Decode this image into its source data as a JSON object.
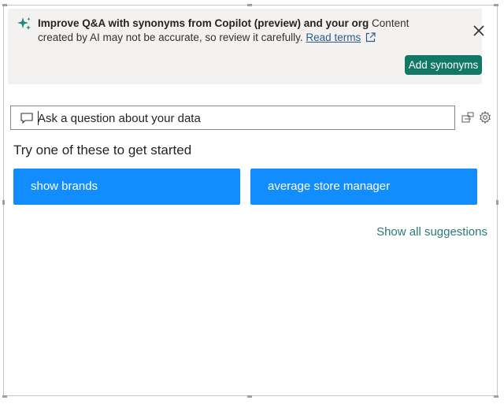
{
  "banner": {
    "title": "Improve Q&A with synonyms from Copilot (preview) and your org",
    "body": " Content created by AI may not be accurate, so review it carefully. ",
    "link": "Read terms",
    "action_label": "Add synonyms",
    "icons": {
      "sparkle": "copilot-sparkle-icon",
      "external": "external-link-icon",
      "close": "close-icon"
    },
    "colors": {
      "background": "#f3f2f1",
      "action_button": "#117865"
    }
  },
  "question": {
    "placeholder": "Ask a question about your data",
    "value": "",
    "icons": {
      "chat": "chat-icon",
      "tool1": "flow-icon",
      "settings": "gear-icon"
    }
  },
  "suggestions": {
    "heading": "Try one of these to get started",
    "items": [
      {
        "label": "show brands"
      },
      {
        "label": "average store manager"
      }
    ],
    "show_all": "Show all suggestions",
    "colors": {
      "button": "#118dff",
      "link": "#2b7a78"
    }
  }
}
